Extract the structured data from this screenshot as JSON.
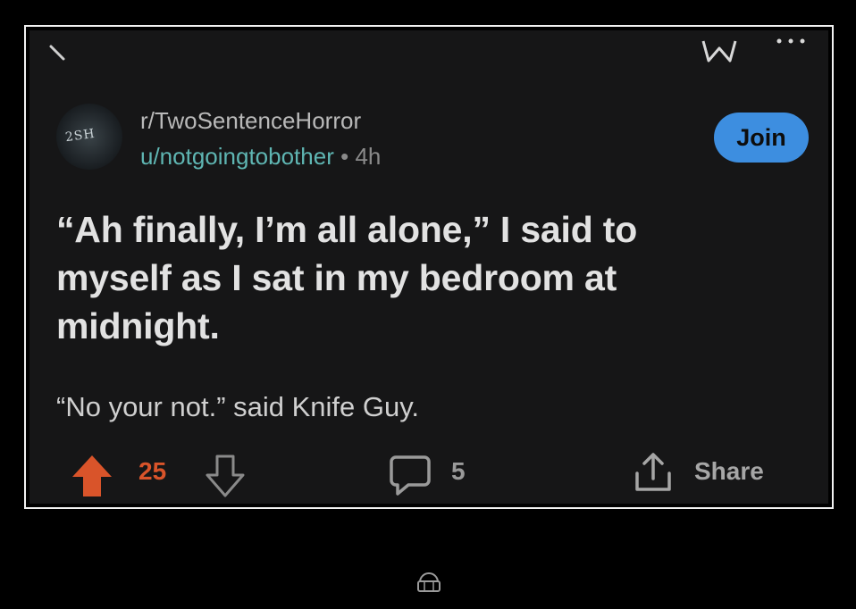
{
  "post": {
    "subreddit": "r/TwoSentenceHorror",
    "username": "u/notgoingtobother",
    "separator": "•",
    "age": "4h",
    "avatar_text": "2SH",
    "join_label": "Join",
    "title": "“Ah finally, I’m all alone,” I said to myself as I sat in my bedroom at midnight.",
    "body": "“No your not.” said Knife Guy."
  },
  "actions": {
    "votes": "25",
    "comments": "5",
    "share_label": "Share"
  },
  "icons": {
    "back": "back-arrow-icon",
    "award": "award-icon",
    "more": "more-options-icon",
    "upvote": "upvote-arrow-icon",
    "downvote": "downvote-arrow-icon",
    "comment": "comment-bubble-icon",
    "share": "share-icon",
    "watermark": "watermark-logo-icon"
  },
  "colors": {
    "background": "#161617",
    "join_button": "#3d8ee0",
    "upvote": "#d9542a",
    "username": "#5fb6b3"
  }
}
